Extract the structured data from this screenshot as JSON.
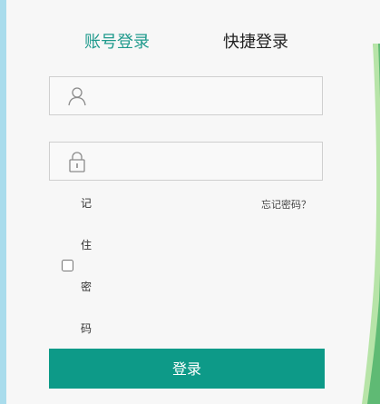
{
  "tabs": {
    "account_login": "账号登录",
    "quick_login": "快捷登录"
  },
  "form": {
    "username_value": "",
    "password_value": "",
    "remember_chars": [
      "记",
      "住",
      "密",
      "码"
    ],
    "forgot_password": "忘记密码？",
    "login_button": "登录"
  },
  "icons": {
    "username": "user-icon",
    "password": "lock-icon"
  },
  "colors": {
    "accent": "#1f9a8c",
    "button": "#0d9a88",
    "left_strip": "#a9dcec"
  }
}
